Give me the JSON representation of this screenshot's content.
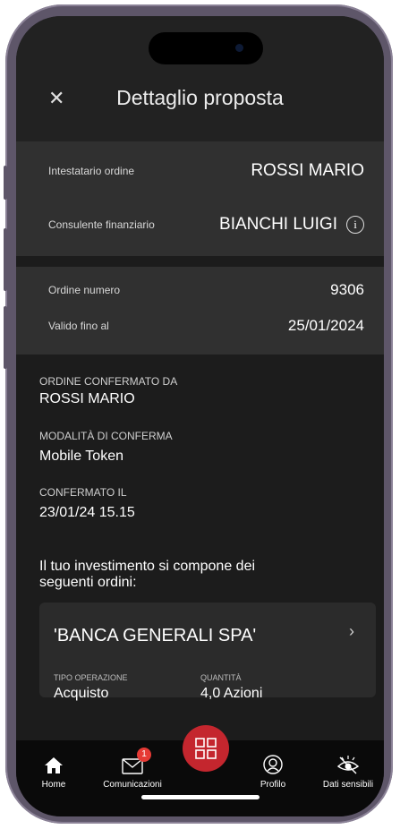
{
  "header": {
    "title": "Dettaglio proposta"
  },
  "summary": {
    "holder_label": "Intestatario ordine",
    "holder_value": "ROSSI MARIO",
    "advisor_label": "Consulente finanziario",
    "advisor_value": "BIANCHI LUIGI",
    "order_number_label": "Ordine numero",
    "order_number_value": "9306",
    "valid_until_label": "Valido fino al",
    "valid_until_value": "25/01/2024"
  },
  "confirmation": {
    "confirmed_by_label": "ORDINE CONFERMATO DA",
    "confirmed_by_value": "ROSSI MARIO",
    "mode_label": "MODALITÀ DI CONFERMA",
    "mode_value": "Mobile Token",
    "confirmed_on_label": "CONFERMATO IL",
    "confirmed_on_value": "23/01/24 15.15"
  },
  "compose_text": "Il tuo investimento si compone dei seguenti ordini:",
  "order": {
    "name": "'BANCA GENERALI SPA'",
    "operation_label": "TIPO OPERAZIONE",
    "operation_value": "Acquisto",
    "quantity_label": "QUANTITÀ",
    "quantity_value": "4,0 Azioni"
  },
  "tabbar": {
    "home": "Home",
    "messages": "Comunicazioni",
    "messages_badge": "1",
    "profile": "Profilo",
    "sensitive": "Dati sensibili"
  },
  "colors": {
    "accent": "#c4262e",
    "badge": "#e63a35",
    "background": "#1c1c1c",
    "card": "#303030"
  }
}
